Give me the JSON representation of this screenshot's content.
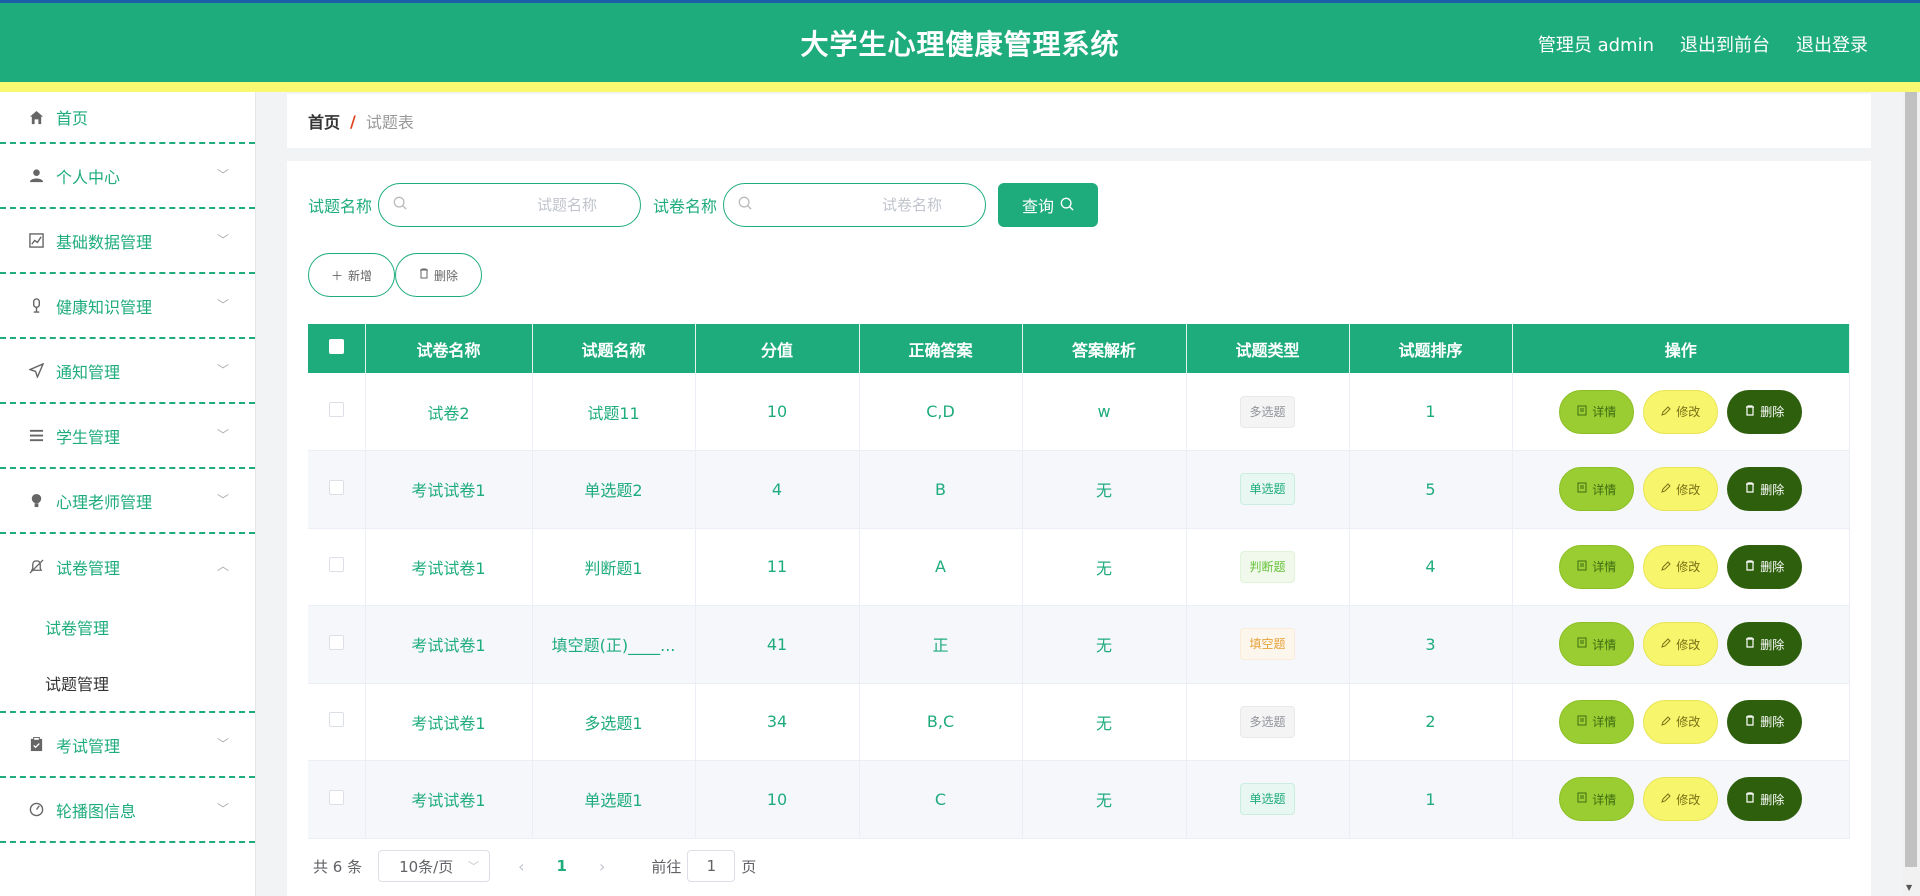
{
  "header": {
    "title": "大学生心理健康管理系统",
    "user": "管理员 admin",
    "to_front": "退出到前台",
    "logout": "退出登录"
  },
  "sidebar": {
    "items": [
      {
        "label": "首页",
        "icon": "home-icon"
      },
      {
        "label": "个人中心",
        "icon": "user-icon"
      },
      {
        "label": "基础数据管理",
        "icon": "chart-icon"
      },
      {
        "label": "健康知识管理",
        "icon": "mic-icon"
      },
      {
        "label": "通知管理",
        "icon": "send-icon"
      },
      {
        "label": "学生管理",
        "icon": "list-icon"
      },
      {
        "label": "心理老师管理",
        "icon": "bulb-icon"
      },
      {
        "label": "试卷管理",
        "icon": "bell-off-icon"
      },
      {
        "label": "考试管理",
        "icon": "clipboard-icon"
      },
      {
        "label": "轮播图信息",
        "icon": "dashboard-icon"
      }
    ],
    "submenu": [
      "试卷管理",
      "试题管理"
    ]
  },
  "breadcrumb": {
    "home": "首页",
    "sep": "/",
    "current": "试题表"
  },
  "search": {
    "label1": "试题名称",
    "placeholder1": "试题名称",
    "label2": "试卷名称",
    "placeholder2": "试卷名称",
    "query": "查询"
  },
  "actions": {
    "add": "新增",
    "delete": "删除"
  },
  "table": {
    "headers": [
      "试卷名称",
      "试题名称",
      "分值",
      "正确答案",
      "答案解析",
      "试题类型",
      "试题排序",
      "操作"
    ],
    "rows": [
      {
        "paper": "试卷2",
        "name": "试题11",
        "score": "10",
        "answer": "C,D",
        "analysis": "w",
        "type": "多选题",
        "type_style": "multi",
        "order": "1"
      },
      {
        "paper": "考试试卷1",
        "name": "单选题2",
        "score": "4",
        "answer": "B",
        "analysis": "无",
        "type": "单选题",
        "type_style": "single",
        "order": "5"
      },
      {
        "paper": "考试试卷1",
        "name": "判断题1",
        "score": "11",
        "answer": "A",
        "analysis": "无",
        "type": "判断题",
        "type_style": "judge",
        "order": "4"
      },
      {
        "paper": "考试试卷1",
        "name": "填空题(正)____...",
        "score": "41",
        "answer": "正",
        "analysis": "无",
        "type": "填空题",
        "type_style": "blank",
        "order": "3"
      },
      {
        "paper": "考试试卷1",
        "name": "多选题1",
        "score": "34",
        "answer": "B,C",
        "analysis": "无",
        "type": "多选题",
        "type_style": "multi",
        "order": "2"
      },
      {
        "paper": "考试试卷1",
        "name": "单选题1",
        "score": "10",
        "answer": "C",
        "analysis": "无",
        "type": "单选题",
        "type_style": "single",
        "order": "1"
      }
    ],
    "op_detail": "详情",
    "op_edit": "修改",
    "op_delete": "删除"
  },
  "pager": {
    "total": "共 6 条",
    "size": "10条/页",
    "page": "1",
    "goto": "前往",
    "input": "1",
    "unit": "页"
  },
  "colors": {
    "primary": "#1fac7c",
    "accent_bar": "#f9f871",
    "detail": "#9acd32",
    "edit": "#f7f56b",
    "delete": "#2d5f0d"
  }
}
